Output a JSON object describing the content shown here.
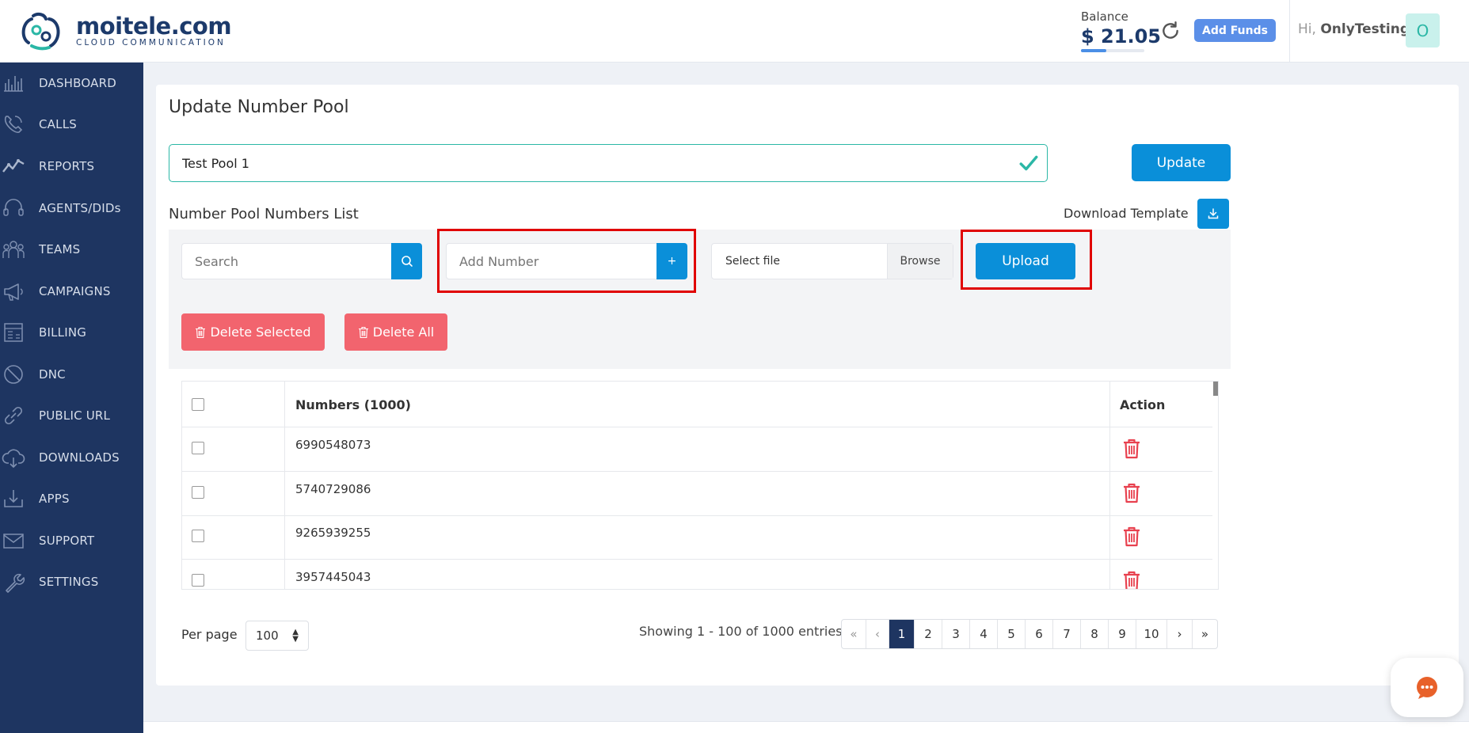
{
  "header": {
    "brand_name": "moitele.com",
    "brand_tagline": "CLOUD COMMUNICATION",
    "balance_label": "Balance",
    "balance_value": "$ 21.05",
    "balance_fill_fraction": 0.4,
    "add_funds_label": "Add Funds",
    "greeting_prefix": "Hi,",
    "user_name": "OnlyTesting",
    "avatar_initial": "O",
    "accent_color": "#5b8fe8"
  },
  "sidebar": {
    "bg_color": "#1e3561",
    "items": [
      {
        "label": "DASHBOARD",
        "icon": "dashboard-icon"
      },
      {
        "label": "CALLS",
        "icon": "phone-icon"
      },
      {
        "label": "REPORTS",
        "icon": "reports-icon"
      },
      {
        "label": "AGENTS/DIDs",
        "icon": "headset-icon"
      },
      {
        "label": "TEAMS",
        "icon": "team-icon"
      },
      {
        "label": "CAMPAIGNS",
        "icon": "megaphone-icon"
      },
      {
        "label": "BILLING",
        "icon": "billing-icon"
      },
      {
        "label": "DNC",
        "icon": "block-icon"
      },
      {
        "label": "PUBLIC URL",
        "icon": "link-icon"
      },
      {
        "label": "DOWNLOADS",
        "icon": "cloud-download-icon"
      },
      {
        "label": "APPS",
        "icon": "apps-download-icon"
      },
      {
        "label": "SUPPORT",
        "icon": "mail-icon"
      },
      {
        "label": "SETTINGS",
        "icon": "wrench-icon"
      }
    ]
  },
  "main": {
    "title": "Update Number Pool",
    "pool_name_value": "Test Pool 1",
    "update_label": "Update",
    "list_title": "Number Pool Numbers List",
    "download_template_label": "Download Template",
    "search_placeholder": "Search",
    "add_number_placeholder": "Add Number",
    "add_button_label": "+",
    "file_label": "Select file",
    "browse_label": "Browse",
    "upload_label": "Upload",
    "delete_selected_label": "Delete Selected",
    "delete_all_label": "Delete All",
    "primary_color": "#0a8fd9",
    "danger_color": "#f2646e",
    "highlight_color": "#e00000"
  },
  "table": {
    "col_numbers": "Numbers (1000)",
    "col_action": "Action",
    "rows": [
      "6990548073",
      "5740729086",
      "9265939255",
      "3957445043"
    ]
  },
  "footer": {
    "per_page_label": "Per page",
    "per_page_value": "100",
    "showing_text": "Showing 1 - 100 of 1000 entries",
    "pages": [
      "«",
      "‹",
      "1",
      "2",
      "3",
      "4",
      "5",
      "6",
      "7",
      "8",
      "9",
      "10",
      "›",
      "»"
    ],
    "active_page": "1"
  }
}
